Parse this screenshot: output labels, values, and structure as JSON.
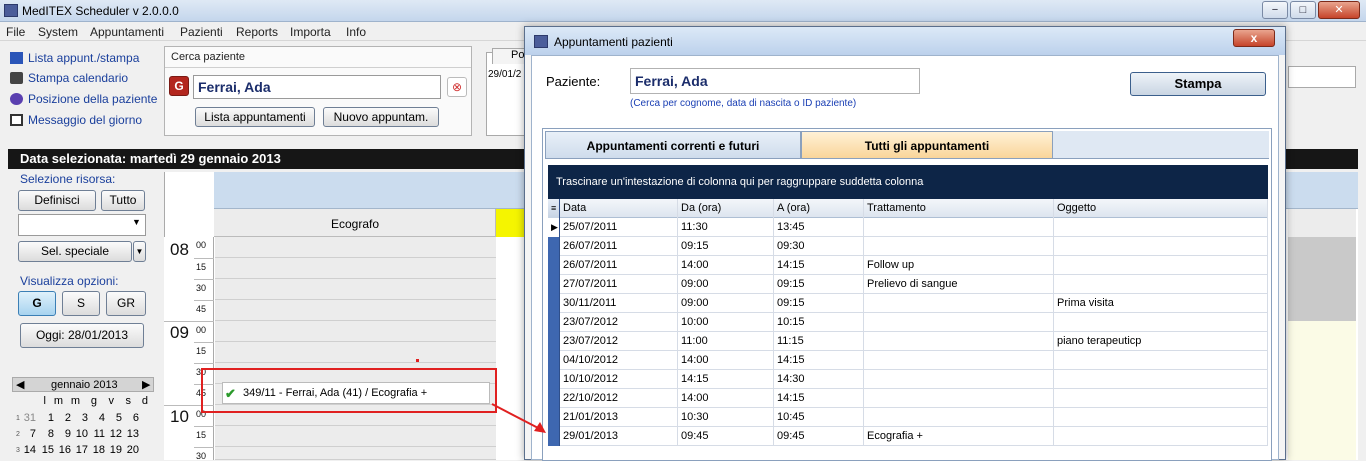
{
  "window": {
    "title": "MedITEX  Scheduler v 2.0.0.0",
    "buttons": [
      "−",
      "□",
      "✕"
    ]
  },
  "menu": [
    "File",
    "System",
    "Appuntamenti",
    "Pazienti",
    "Reports",
    "Importa",
    "Info"
  ],
  "left_links": [
    {
      "label": "Lista appunt./stampa",
      "icon": "list-icon"
    },
    {
      "label": "Stampa calendario",
      "icon": "printer-icon"
    },
    {
      "label": "Posizione della paziente",
      "icon": "position-icon"
    },
    {
      "label": "Messaggio del giorno",
      "icon": "message-icon"
    }
  ],
  "search_panel": {
    "title": "Cerca paziente",
    "value": "Ferrai, Ada",
    "btn_list": "Lista appuntamenti",
    "btn_new": "Nuovo appuntam."
  },
  "bg_panel": {
    "tab": "Po",
    "date": "29/01/2"
  },
  "date_header": "Data selezionata: martedì 29 gennaio 2013",
  "resource": {
    "label": "Selezione risorsa:",
    "btn_define": "Definisci",
    "btn_all": "Tutto",
    "btn_special": "Sel. speciale"
  },
  "view": {
    "label": "Visualizza opzioni:",
    "btn_g": "G",
    "btn_s": "S",
    "btn_gr": "GR",
    "btn_today": "Oggi: 28/01/2013"
  },
  "calendar": {
    "month": "gennaio 2013",
    "weekdays": [
      "l",
      "m",
      "m",
      "g",
      "v",
      "s",
      "d"
    ],
    "rows": [
      {
        "week": "1",
        "days": [
          "31",
          "1",
          "2",
          "3",
          "4",
          "5",
          "6"
        ]
      },
      {
        "week": "2",
        "days": [
          "7",
          "8",
          "9",
          "10",
          "11",
          "12",
          "13"
        ]
      },
      {
        "week": "3",
        "days": [
          "14",
          "15",
          "16",
          "17",
          "18",
          "19",
          "20"
        ]
      }
    ]
  },
  "schedule": {
    "column": "Ecografo",
    "hours": [
      "08",
      "09",
      "10"
    ],
    "minutes": [
      "00",
      "15",
      "30",
      "45"
    ],
    "appointment": "349/11 - Ferrai, Ada (41) / Ecografia +"
  },
  "dialog": {
    "title": "Appuntamenti pazienti",
    "close": "x",
    "patient_label": "Paziente:",
    "patient_value": "Ferrai, Ada",
    "hint": "(Cerca per cognome, data di nascita o ID paziente)",
    "print": "Stampa",
    "tabs": [
      "Appuntamenti correnti e futuri",
      "Tutti gli appuntamenti"
    ],
    "group_hint": "Trascinare un'intestazione di colonna qui per raggruppare suddetta colonna",
    "columns": [
      "Data",
      "Da (ora)",
      "A (ora)",
      "Trattamento",
      "Oggetto"
    ],
    "rows": [
      [
        "25/07/2011",
        "11:30",
        "13:45",
        "",
        ""
      ],
      [
        "26/07/2011",
        "09:15",
        "09:30",
        "",
        ""
      ],
      [
        "26/07/2011",
        "14:00",
        "14:15",
        "Follow up",
        ""
      ],
      [
        "27/07/2011",
        "09:00",
        "09:15",
        "Prelievo di sangue",
        ""
      ],
      [
        "30/11/2011",
        "09:00",
        "09:15",
        "",
        "Prima visita"
      ],
      [
        "23/07/2012",
        "10:00",
        "10:15",
        "",
        ""
      ],
      [
        "23/07/2012",
        "11:00",
        "11:15",
        "",
        "piano terapeuticp"
      ],
      [
        "04/10/2012",
        "14:00",
        "14:15",
        "",
        ""
      ],
      [
        "10/10/2012",
        "14:15",
        "14:30",
        "",
        ""
      ],
      [
        "22/10/2012",
        "14:00",
        "14:15",
        "",
        ""
      ],
      [
        "21/01/2013",
        "10:30",
        "10:45",
        "",
        ""
      ],
      [
        "29/01/2013",
        "09:45",
        "09:45",
        "Ecografia +",
        ""
      ]
    ]
  },
  "colors": {
    "highlight": "#e02020",
    "header_dark": "#0d2547",
    "tab_active": "#f9d59a"
  }
}
